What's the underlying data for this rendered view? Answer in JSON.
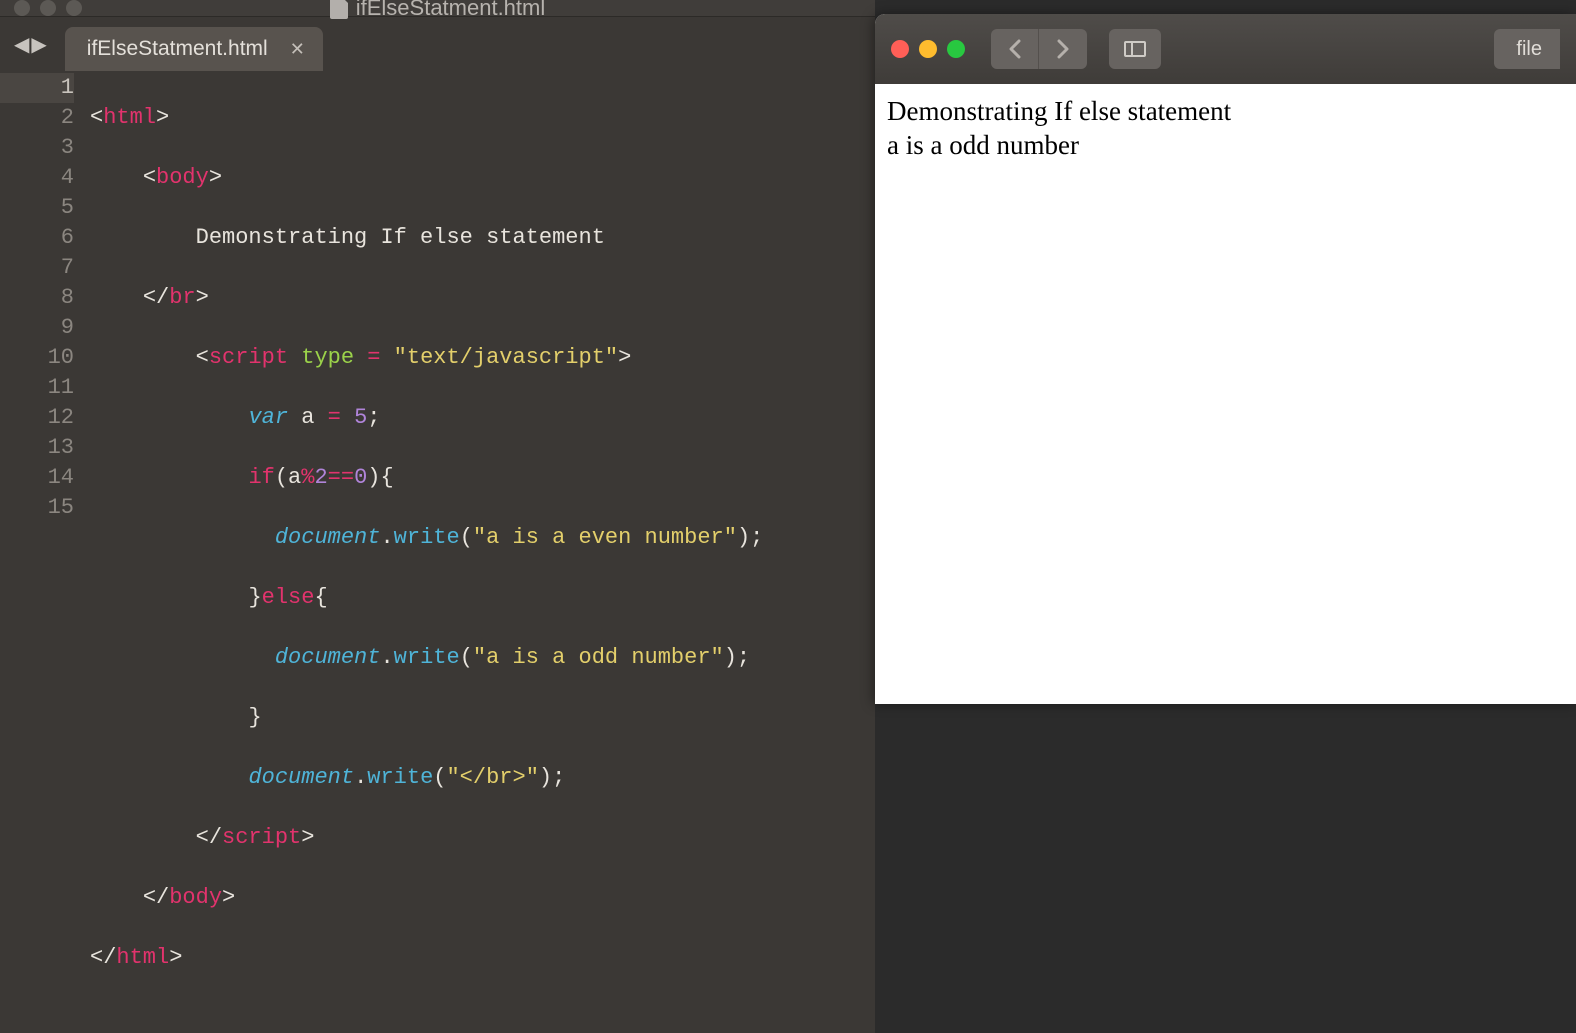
{
  "editor": {
    "title": "ifElseStatment.html",
    "tab_label": "ifElseStatment.html",
    "gutter": [
      "1",
      "2",
      "3",
      "4",
      "5",
      "6",
      "7",
      "8",
      "9",
      "10",
      "11",
      "12",
      "13",
      "14",
      "15"
    ],
    "code": {
      "l1": {
        "t": "html"
      },
      "l2": {
        "t": "body"
      },
      "l3": {
        "txt": "Demonstrating If else statement"
      },
      "l4": {
        "t": "br"
      },
      "l5": {
        "t": "script",
        "attr": "type",
        "val": "\"text/javascript\""
      },
      "l6": {
        "kw": "var",
        "id": "a",
        "eq": "=",
        "num": "5"
      },
      "l7": {
        "kw": "if",
        "cond1": "a",
        "op": "%",
        "num": "2",
        "cmp": "==",
        "zero": "0"
      },
      "l8": {
        "obj": "document",
        "m": "write",
        "s": "\"a is a even number\""
      },
      "l9": {
        "kw": "else"
      },
      "l10": {
        "obj": "document",
        "m": "write",
        "s": "\"a is a odd number\""
      },
      "l12": {
        "obj": "document",
        "m": "write",
        "s": "\"</br>\""
      },
      "l13": {
        "t": "script"
      },
      "l14": {
        "t": "body"
      },
      "l15": {
        "t": "html"
      }
    }
  },
  "browser": {
    "url_hint": "file",
    "output_line1": "Demonstrating If else statement",
    "output_line2": "a is a odd number"
  }
}
